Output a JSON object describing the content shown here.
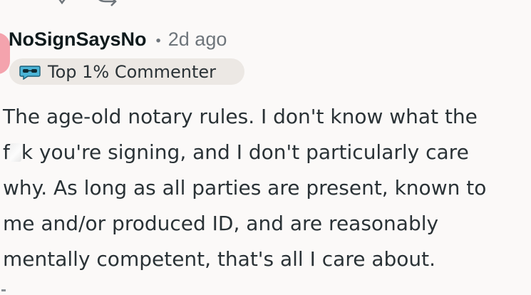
{
  "comment": {
    "author": "NoSignSaysNo",
    "separator": "•",
    "time_ago": "2d ago",
    "badge": {
      "icon": "sunglasses-speech-icon",
      "label": "Top 1% Commenter"
    },
    "body_lines": [
      "The age-old notary rules. I don't know what the",
      "f",
      "k you're signing, and I don't particularly care",
      "why. As long as all parties are present, known to",
      "me and/or produced ID, and are reasonably",
      "mentally competent, that's all I care about."
    ]
  },
  "colors": {
    "background": "#fbf9f8",
    "text": "#2a3236",
    "muted": "#6e757b",
    "badge_bg": "#ece8e4",
    "avatar": "#f4a3ad"
  }
}
